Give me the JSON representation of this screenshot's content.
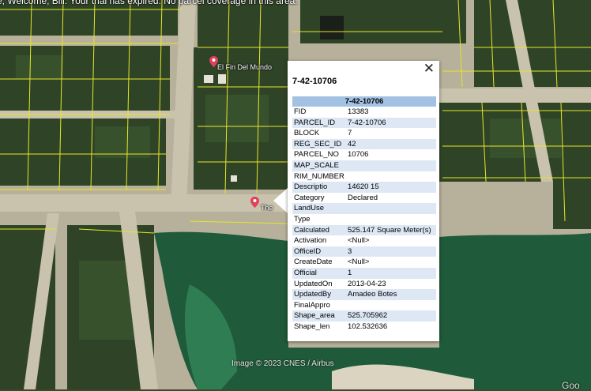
{
  "banner": "e, Welcome, Bill. Your trial has expired. No parcel coverage in this area.",
  "places": [
    {
      "label": "El Fin Del Mundo"
    },
    {
      "label": "The"
    }
  ],
  "attribution": "Image © 2023 CNES / Airbus",
  "corner_text": "Goo",
  "popup": {
    "title": "7-42-10706",
    "close_label": "✕",
    "table_header": "7-42-10706",
    "rows": [
      {
        "key": "FID",
        "value": "13383"
      },
      {
        "key": "PARCEL_ID",
        "value": "7-42-10706"
      },
      {
        "key": "BLOCK",
        "value": "7"
      },
      {
        "key": "REG_SEC_ID",
        "value": "42"
      },
      {
        "key": "PARCEL_NO",
        "value": "10706"
      },
      {
        "key": "MAP_SCALE",
        "value": ""
      },
      {
        "key": "RIM_NUMBER",
        "value": ""
      },
      {
        "key": "Descriptio",
        "value": "14620 15"
      },
      {
        "key": "Category",
        "value": "Declared"
      },
      {
        "key": "LandUse",
        "value": ""
      },
      {
        "key": "Type",
        "value": ""
      },
      {
        "key": "Calculated",
        "value": "525.147 Square Meter(s)"
      },
      {
        "key": "Activation",
        "value": "<Null>"
      },
      {
        "key": "OfficeID",
        "value": "3"
      },
      {
        "key": "CreateDate",
        "value": "<Null>"
      },
      {
        "key": "Official",
        "value": "1"
      },
      {
        "key": "UpdatedOn",
        "value": "2013-04-23"
      },
      {
        "key": "UpdatedBy",
        "value": "Amadeo Botes"
      },
      {
        "key": "FinalAppro",
        "value": ""
      },
      {
        "key": "Shape_area",
        "value": "525.705962"
      },
      {
        "key": "Shape_len",
        "value": "102.532636"
      }
    ]
  },
  "colors": {
    "parcel_lines": "#e6e62a",
    "pin": "#e0405a",
    "table_header": "#a3c2e3",
    "row_alt": "#dde8f4"
  }
}
